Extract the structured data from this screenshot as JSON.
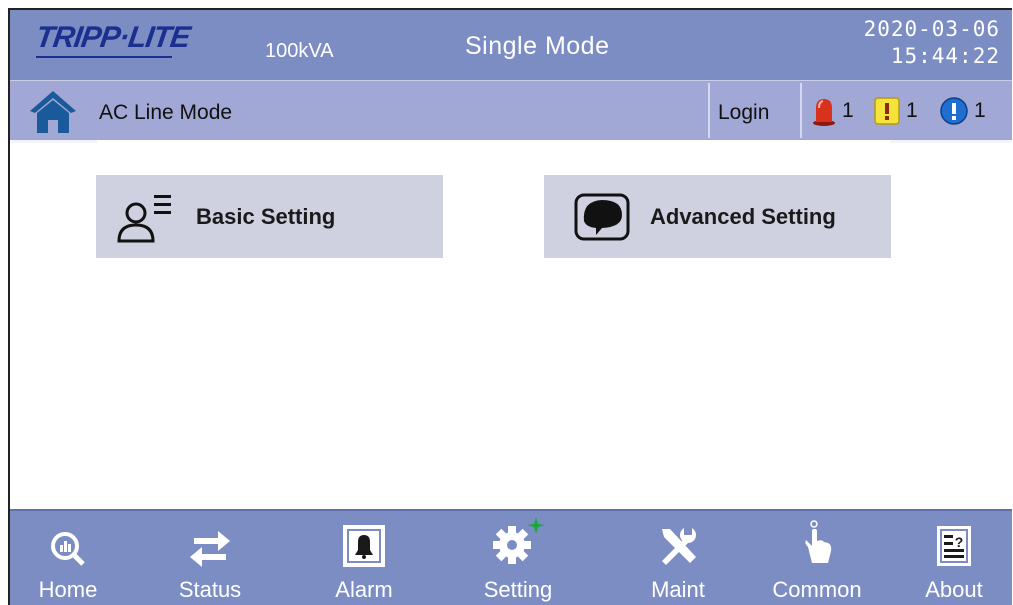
{
  "header": {
    "brand": "TRIPP·LITE",
    "capacity": "100kVA",
    "mode": "Single Mode",
    "date": "2020-03-06",
    "time": "15:44:22"
  },
  "status": {
    "line_mode": "AC Line Mode",
    "login_label": "Login",
    "alarms": [
      {
        "type": "critical",
        "icon": "red-siren-icon",
        "count": "1"
      },
      {
        "type": "warning",
        "icon": "yellow-exclamation-icon",
        "count": "1"
      },
      {
        "type": "info",
        "icon": "blue-info-icon",
        "count": "1"
      }
    ]
  },
  "main": {
    "basic_setting": "Basic Setting",
    "advanced_setting": "Advanced Setting"
  },
  "nav": [
    {
      "label": "Home",
      "icon": "home-chart-icon"
    },
    {
      "label": "Status",
      "icon": "status-arrows-icon"
    },
    {
      "label": "Alarm",
      "icon": "alarm-bell-icon"
    },
    {
      "label": "Setting",
      "icon": "setting-gear-icon",
      "active": true
    },
    {
      "label": "Maint",
      "icon": "maint-tools-icon"
    },
    {
      "label": "Common",
      "icon": "common-hand-icon"
    },
    {
      "label": "About",
      "icon": "about-doc-icon"
    }
  ],
  "colors": {
    "topbar": "#7c8dc4",
    "statusbar": "#a2a8d6",
    "button": "#cfd0e0",
    "brand": "#1a2f8e",
    "active_star": "#18a83a"
  }
}
